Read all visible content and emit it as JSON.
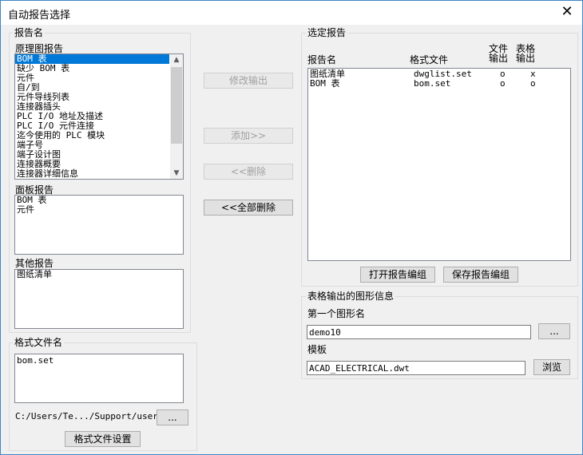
{
  "window": {
    "title": "自动报告选择",
    "close_label": "✕"
  },
  "report_name_group": {
    "label": "报告名"
  },
  "schematic_reports": {
    "label": "原理图报告",
    "items": [
      {
        "label": "BOM 表",
        "selected": true
      },
      {
        "label": "缺少 BOM 表",
        "selected": false
      },
      {
        "label": "元件",
        "selected": false
      },
      {
        "label": "自/到",
        "selected": false
      },
      {
        "label": "元件导线列表",
        "selected": false
      },
      {
        "label": "连接器插头",
        "selected": false
      },
      {
        "label": "PLC I/O 地址及描述",
        "selected": false
      },
      {
        "label": "PLC I/O 元件连接",
        "selected": false
      },
      {
        "label": "迄今使用的 PLC 模块",
        "selected": false
      },
      {
        "label": "端子号",
        "selected": false
      },
      {
        "label": "端子设计图",
        "selected": false
      },
      {
        "label": "连接器概要",
        "selected": false
      },
      {
        "label": "连接器详细信息",
        "selected": false
      }
    ]
  },
  "panel_reports": {
    "label": "面板报告",
    "items": [
      "BOM 表",
      "元件"
    ]
  },
  "other_reports": {
    "label": "其他报告",
    "items": [
      "图纸清单"
    ]
  },
  "format_file_group": {
    "label": "格式文件名",
    "items": [
      "bom.set"
    ],
    "path": "C:/Users/Te.../Support/user/",
    "browse_label": "...",
    "settings_label": "格式文件设置"
  },
  "middle_buttons": {
    "modify": "修改输出",
    "add": "添加>>",
    "remove": "<<删除",
    "remove_all": "<<全部删除"
  },
  "selected_reports": {
    "label": "选定报告",
    "columns": {
      "name": "报告名",
      "format": "格式文件",
      "file_output": "文件\n输出",
      "table_output": "表格\n输出"
    },
    "rows": [
      {
        "name": "图纸清单",
        "format": "dwglist.set",
        "file_output": "o",
        "table_output": "x"
      },
      {
        "name": "BOM 表",
        "format": "bom.set",
        "file_output": "o",
        "table_output": "o"
      }
    ],
    "open_group_label": "打开报告编组",
    "save_group_label": "保存报告编组"
  },
  "table_output_info": {
    "label": "表格输出的图形信息",
    "first_drawing_label": "第一个图形名",
    "first_drawing_value": "demo10",
    "browse_label": "...",
    "template_label": "模板",
    "template_value": "ACAD_ELECTRICAL.dwt",
    "template_browse_label": "浏览"
  },
  "icons": {
    "scroll_up": "▲",
    "scroll_down": "▼"
  }
}
